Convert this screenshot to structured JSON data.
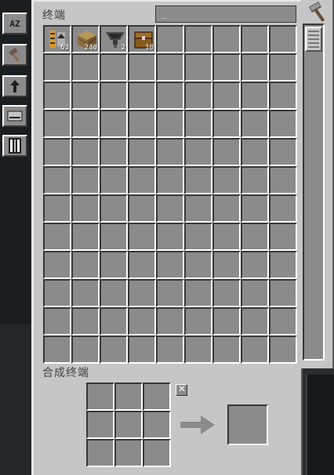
{
  "terminal": {
    "title": "终端",
    "search_value": "_",
    "items": [
      {
        "name": "conveyor-item",
        "count": "63"
      },
      {
        "name": "planks-item",
        "count": "240"
      },
      {
        "name": "hopper-item",
        "count": "2"
      },
      {
        "name": "chest-item",
        "count": "10"
      }
    ]
  },
  "sidebar": {
    "sort_label": "AZ",
    "buttons": [
      "sort-az-button",
      "sort-hammer-button",
      "sort-direction-button",
      "view-mode-button",
      "search-mode-button"
    ]
  },
  "crafting": {
    "title": "合成终端"
  },
  "icons": {
    "clear": "✕"
  }
}
